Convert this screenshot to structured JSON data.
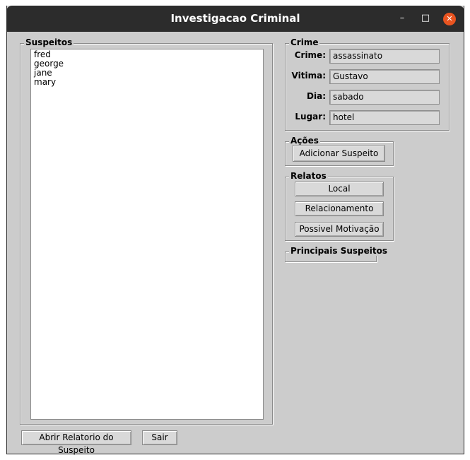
{
  "window": {
    "title": "Investigacao Criminal",
    "minimize": "–",
    "maximize": "□",
    "close": "✕"
  },
  "suspeitos": {
    "legend": "Suspeitos",
    "items": [
      "fred",
      "george",
      "jane",
      "mary"
    ]
  },
  "crime": {
    "legend": "Crime",
    "fields": [
      {
        "label": "Crime:",
        "value": "assassinato"
      },
      {
        "label": "Vitima:",
        "value": "Gustavo"
      },
      {
        "label": "Dia:",
        "value": "sabado"
      },
      {
        "label": "Lugar:",
        "value": "hotel"
      }
    ]
  },
  "acoes": {
    "legend": "Ações",
    "add_suspect": "Adicionar Suspeito"
  },
  "relatos": {
    "legend": "Relatos",
    "local": "Local",
    "relacionamento": "Relacionamento",
    "motivacao": "Possivel Motivação"
  },
  "principais": {
    "legend": "Principais Suspeitos"
  },
  "bottom": {
    "open_report": "Abrir Relatorio do Suspeito",
    "exit": "Sair"
  }
}
